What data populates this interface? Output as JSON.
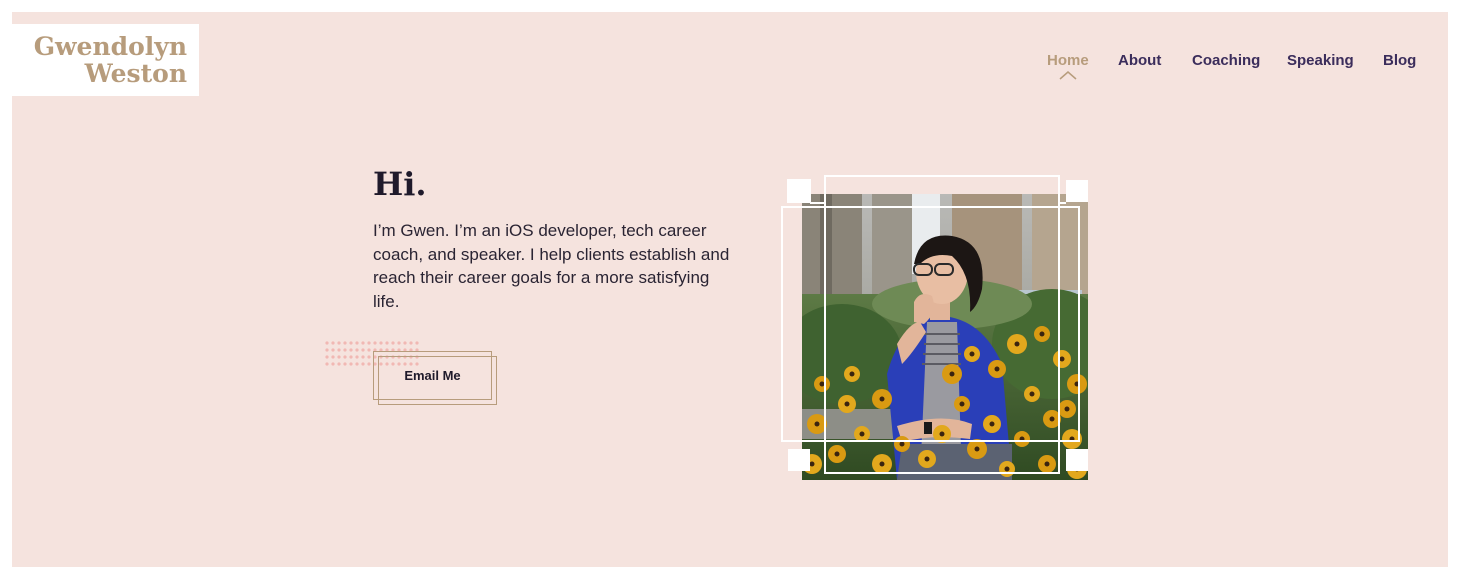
{
  "brand": {
    "line1": "Gwendolyn",
    "line2": "Weston"
  },
  "nav": {
    "items": [
      {
        "label": "Home"
      },
      {
        "label": "About"
      },
      {
        "label": "Coaching"
      },
      {
        "label": "Speaking"
      },
      {
        "label": "Blog"
      }
    ],
    "active": "Home"
  },
  "hero": {
    "title": "Hi.",
    "text": "I’m Gwen. I’m an iOS developer, tech career coach, and speaker. I help clients establish and reach their career goals for a more satisfying life.",
    "button_label": "Email Me"
  },
  "colors": {
    "background": "#f5e3de",
    "accent": "#b79c7c",
    "nav_text": "#3b2d5b",
    "dots": "#f1b8b3"
  },
  "icons": {
    "active_nav_marker": "chevron-up-icon"
  }
}
